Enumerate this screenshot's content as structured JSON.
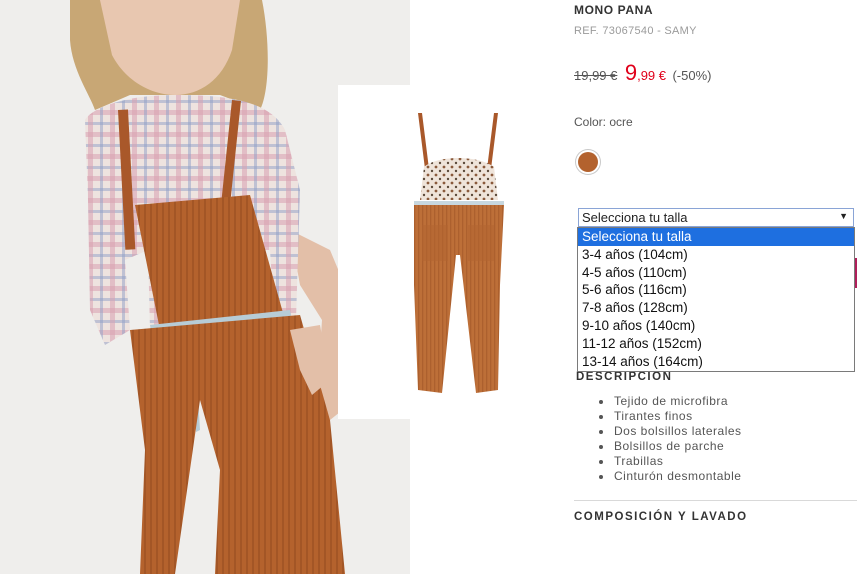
{
  "product": {
    "title": "MONO PANA",
    "ref": "REF. 73067540 - SAMY",
    "price_old": "19,99 €",
    "price_new_int": "9",
    "price_new_dec": ",99 €",
    "discount": "(-50%)",
    "color_label": "Color: ocre",
    "swatch_color": "#b3622e"
  },
  "size": {
    "selected": "Selecciona tu talla",
    "options": [
      "Selecciona tu talla",
      "3-4 años (104cm)",
      "4-5 años (110cm)",
      "5-6 años (116cm)",
      "7-8 años (128cm)",
      "9-10 años (140cm)",
      "11-12 años (152cm)",
      "13-14 años (164cm)"
    ]
  },
  "description": {
    "title": "DESCRIPCIÓN",
    "items": [
      "Tejido de microfibra",
      "Tirantes finos",
      "Dos bolsillos laterales",
      "Bolsillos de parche",
      "Trabillas",
      "Cinturón desmontable"
    ]
  },
  "composition": {
    "title": "COMPOSICIÓN Y LAVADO"
  },
  "colors": {
    "sale": "#e0001a",
    "highlight": "#1e6fe0",
    "accent_peek": "#b01f5a"
  }
}
